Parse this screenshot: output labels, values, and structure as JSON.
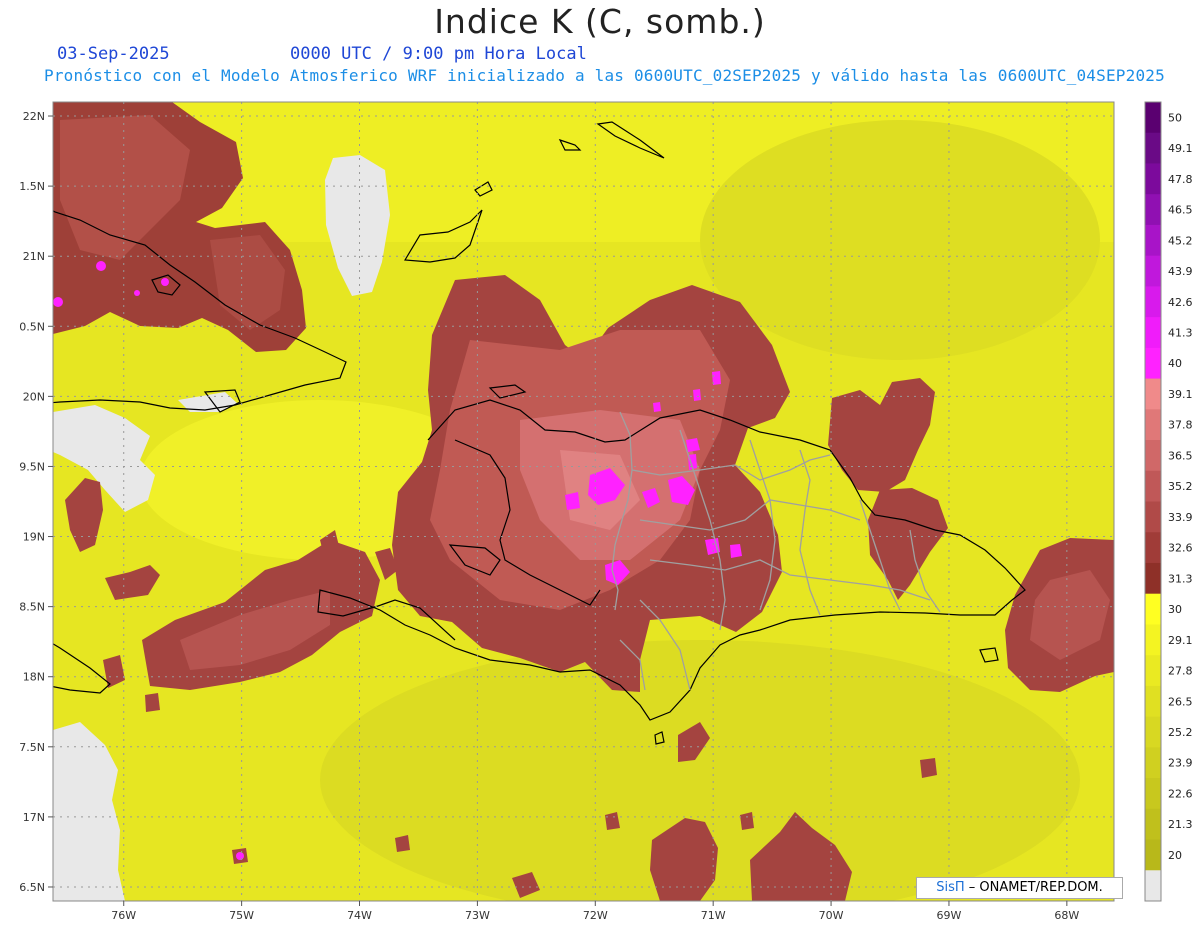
{
  "header": {
    "title": "Indice K (C, somb.)",
    "date": "03-Sep-2025",
    "time_label": "0000 UTC / 9:00 pm Hora Local",
    "forecast_line": "Pronóstico con el Modelo Atmosferico WRF inicializado a las 0600UTC_02SEP2025 y válido hasta las  0600UTC_04SEP2025"
  },
  "credit": {
    "logo_text": "SisΠ",
    "org_text": "– ONAMET/REP.DOM."
  },
  "map": {
    "lon_range": [
      -76.6,
      -67.6
    ],
    "lat_range": [
      16.4,
      22.1
    ],
    "lon_ticks": [
      {
        "value": -76,
        "label": "76W"
      },
      {
        "value": -75,
        "label": "75W"
      },
      {
        "value": -74,
        "label": "74W"
      },
      {
        "value": -73,
        "label": "73W"
      },
      {
        "value": -72,
        "label": "72W"
      },
      {
        "value": -71,
        "label": "71W"
      },
      {
        "value": -70,
        "label": "70W"
      },
      {
        "value": -69,
        "label": "69W"
      },
      {
        "value": -68,
        "label": "68W"
      }
    ],
    "lat_ticks": [
      {
        "value": 22,
        "label": "22N"
      },
      {
        "value": 21.5,
        "label": "1.5N"
      },
      {
        "value": 21,
        "label": "21N"
      },
      {
        "value": 20.5,
        "label": "0.5N"
      },
      {
        "value": 20,
        "label": "20N"
      },
      {
        "value": 19.5,
        "label": "9.5N"
      },
      {
        "value": 19,
        "label": "19N"
      },
      {
        "value": 18.5,
        "label": "8.5N"
      },
      {
        "value": 18,
        "label": "18N"
      },
      {
        "value": 17.5,
        "label": "7.5N"
      },
      {
        "value": 17,
        "label": "17N"
      },
      {
        "value": 16.5,
        "label": "6.5N"
      }
    ],
    "grid": true,
    "background_color": "#eeee22",
    "ocean_color": "#dddd22",
    "missing_color": "#e8e8e8",
    "coast_color": "#000000",
    "border_color": "#a0a0a0"
  },
  "legend": {
    "placement": "right",
    "bins": [
      {
        "label": "50",
        "color": "#5a0070"
      },
      {
        "label": "49.1",
        "color": "#6a0a86"
      },
      {
        "label": "47.8",
        "color": "#7c0a9c"
      },
      {
        "label": "46.5",
        "color": "#9010b2"
      },
      {
        "label": "45.2",
        "color": "#a814c8"
      },
      {
        "label": "43.9",
        "color": "#c018dc"
      },
      {
        "label": "42.6",
        "color": "#d81aec"
      },
      {
        "label": "41.3",
        "color": "#f01cfa"
      },
      {
        "label": "40",
        "color": "#ff22ff"
      },
      {
        "label": "39.1",
        "color": "#f08a8a"
      },
      {
        "label": "37.8",
        "color": "#e07878"
      },
      {
        "label": "36.5",
        "color": "#d06868"
      },
      {
        "label": "35.2",
        "color": "#c05858"
      },
      {
        "label": "33.9",
        "color": "#b04a48"
      },
      {
        "label": "32.6",
        "color": "#a03c38"
      },
      {
        "label": "31.3",
        "color": "#8e3028"
      },
      {
        "label": "30",
        "color": "#ffff22"
      },
      {
        "label": "29.1",
        "color": "#f4f422"
      },
      {
        "label": "27.8",
        "color": "#eaea22"
      },
      {
        "label": "26.5",
        "color": "#e0e022"
      },
      {
        "label": "25.2",
        "color": "#d8d822"
      },
      {
        "label": "23.9",
        "color": "#d0d020"
      },
      {
        "label": "22.6",
        "color": "#c8c81e"
      },
      {
        "label": "21.3",
        "color": "#c0c01c"
      },
      {
        "label": "20",
        "color": "#b8b81a"
      },
      {
        "label": "",
        "color": "#e8e8e8"
      }
    ]
  }
}
